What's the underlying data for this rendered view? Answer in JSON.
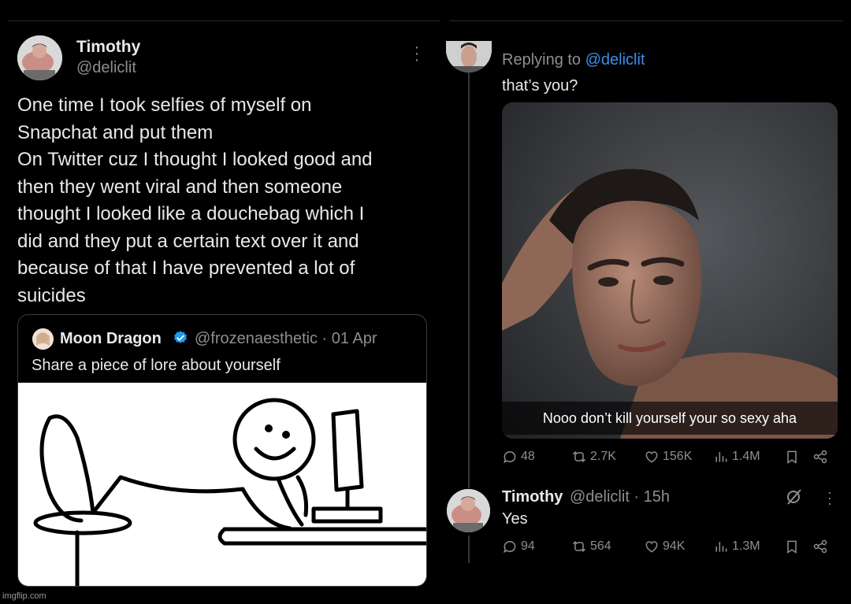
{
  "left_tweet": {
    "name": "Timothy",
    "handle": "@deliclit",
    "body_lines": [
      "One time I took selfies of myself on",
      "Snapchat and put them",
      "On Twitter cuz I thought I looked good and",
      "then they went viral and then someone",
      "thought I looked like a douchebag which I",
      "did and they put a certain text over it and",
      "because of that I have prevented a lot of",
      "suicides"
    ],
    "quote": {
      "name": "Moon Dragon",
      "handle_date": "@frozenaesthetic · 01 Apr",
      "text": "Share a piece of lore about yourself"
    }
  },
  "reply_tweet": {
    "replying_prefix": "Replying to ",
    "replying_handle": "@deliclit",
    "text": "that’s you?",
    "photo_caption": "Nooo don’t kill yourself your so sexy aha",
    "stats": {
      "replies": "48",
      "retweets": "2.7K",
      "likes": "156K",
      "views": "1.4M"
    }
  },
  "timothy_reply": {
    "name": "Timothy",
    "meta": "@deliclit · 15h",
    "text": "Yes",
    "stats": {
      "replies": "94",
      "retweets": "564",
      "likes": "94K",
      "views": "1.3M"
    }
  },
  "watermark": "imgflip.com",
  "colors": {
    "background": "#000000",
    "muted": "#8b8f94",
    "link": "#3b8ee8",
    "verified": "#1d9bf0"
  },
  "icons": [
    "more-icon",
    "verified-icon",
    "reply-icon",
    "retweet-icon",
    "like-icon",
    "views-icon",
    "bookmark-icon",
    "share-icon",
    "grok-icon"
  ]
}
